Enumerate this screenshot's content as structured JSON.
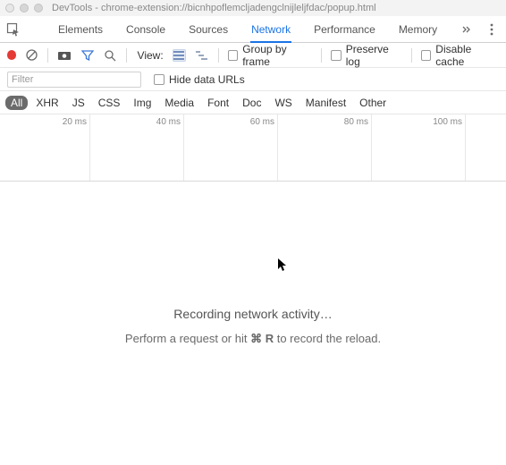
{
  "window": {
    "title": "DevTools - chrome-extension://bicnhpoflemcljadengclnijleljfdac/popup.html"
  },
  "tabs": {
    "items": [
      "Elements",
      "Console",
      "Sources",
      "Network",
      "Performance",
      "Memory"
    ],
    "active_index": 3
  },
  "toolbar": {
    "view_label": "View:",
    "group_by_frame": "Group by frame",
    "preserve_log": "Preserve log",
    "disable_cache": "Disable cache"
  },
  "filter": {
    "placeholder": "Filter",
    "hide_data_urls": "Hide data URLs"
  },
  "types": {
    "items": [
      "All",
      "XHR",
      "JS",
      "CSS",
      "Img",
      "Media",
      "Font",
      "Doc",
      "WS",
      "Manifest",
      "Other"
    ],
    "active_index": 0
  },
  "timeline": {
    "ticks": [
      "20 ms",
      "40 ms",
      "60 ms",
      "80 ms",
      "100 ms"
    ]
  },
  "empty_state": {
    "line1": "Recording network activity…",
    "line2_before": "Perform a request or hit ",
    "shortcut_modifier": "⌘",
    "shortcut_key": "R",
    "line2_after": " to record the reload."
  },
  "icons": {
    "inspect": "inspect-element-icon",
    "record": "record-icon",
    "clear": "clear-icon",
    "camera": "screenshot-icon",
    "filter": "filter-icon",
    "search": "search-icon",
    "view_large": "large-rows-icon",
    "view_waterfall": "waterfall-icon",
    "overflow": "chevrons-icon",
    "menu": "kebab-menu-icon"
  }
}
